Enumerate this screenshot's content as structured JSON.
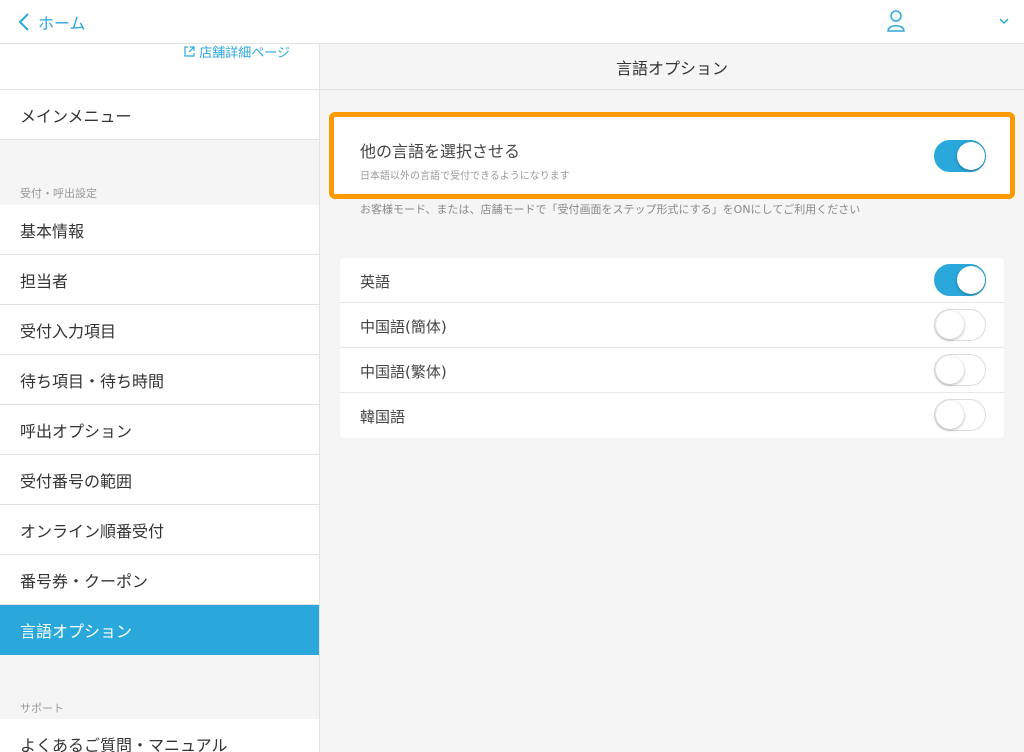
{
  "header": {
    "back_label": "ホーム",
    "accent_color": "#2aa8dc"
  },
  "sidebar": {
    "store_link": "店舗詳細ページ",
    "main_menu": "メインメニュー",
    "section_reception": "受付・呼出設定",
    "items": [
      {
        "label": "基本情報",
        "active": false
      },
      {
        "label": "担当者",
        "active": false
      },
      {
        "label": "受付入力項目",
        "active": false
      },
      {
        "label": "待ち項目・待ち時間",
        "active": false
      },
      {
        "label": "呼出オプション",
        "active": false
      },
      {
        "label": "受付番号の範囲",
        "active": false
      },
      {
        "label": "オンライン順番受付",
        "active": false
      },
      {
        "label": "番号券・クーポン",
        "active": false
      },
      {
        "label": "言語オプション",
        "active": true
      }
    ],
    "section_support": "サポート",
    "support_items": [
      {
        "label": "よくあるご質問・マニュアル"
      }
    ]
  },
  "main": {
    "title": "言語オプション",
    "primary_toggle": {
      "title": "他の言語を選択させる",
      "subtitle": "日本語以外の言語で受付できるようになります",
      "on": true
    },
    "note": "お客様モード、または、店舗モードで「受付画面をステップ形式にする」をONにしてご利用ください",
    "languages": [
      {
        "label": "英語",
        "on": true
      },
      {
        "label": "中国語(簡体)",
        "on": false
      },
      {
        "label": "中国語(繁体)",
        "on": false
      },
      {
        "label": "韓国語",
        "on": false
      }
    ],
    "highlight_color": "#ff9a00"
  }
}
